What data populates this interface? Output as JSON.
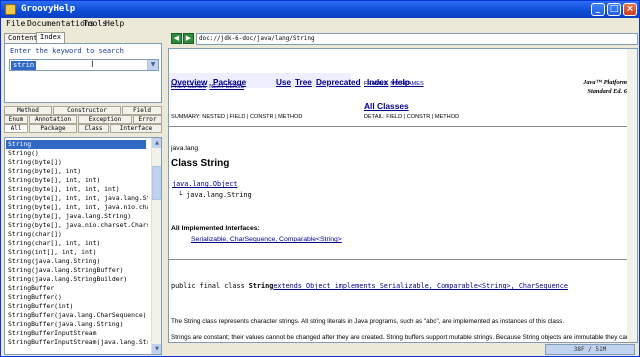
{
  "app": {
    "title": "GroovyHelp",
    "controls": {
      "min": "_",
      "max": "□",
      "close": "×"
    }
  },
  "menu": [
    "File",
    "Documentations",
    "Tools",
    "Help"
  ],
  "left_tabs": [
    "Content",
    "Index"
  ],
  "search": {
    "label": "Enter the keyword to search",
    "value": "strin"
  },
  "filters_row1": [
    "Method",
    "Constructor",
    "Field"
  ],
  "filters_row2": [
    "Enum",
    "Annotation",
    "Exception",
    "Error"
  ],
  "filters_row3": [
    "All",
    "Package",
    "Class",
    "Interface"
  ],
  "results": [
    "String",
    "String()",
    "String(byte[])",
    "String(byte[], int)",
    "String(byte[], int, int)",
    "String(byte[], int, int, int)",
    "String(byte[], int, int, java.lang.String)",
    "String(byte[], int, int, java.nio.charset.C",
    "String(byte[], java.lang.String)",
    "String(byte[], java.nio.charset.Charset)",
    "String(char[])",
    "String(char[], int, int)",
    "String(int[], int, int)",
    "String(java.lang.String)",
    "String(java.lang.StringBuffer)",
    "String(java.lang.StringBuilder)",
    "StringBuffer",
    "StringBuffer()",
    "StringBuffer(int)",
    "StringBuffer(java.lang.CharSequence)",
    "StringBuffer(java.lang.String)",
    "StringBufferInputStream",
    "StringBufferInputStream(java.lang.String)"
  ],
  "url": "doc://jdk-6-doc/java/lang/String",
  "doc": {
    "nav": [
      "Overview",
      "Package",
      "Use",
      "Tree",
      "Deprecated",
      "Index",
      "Help"
    ],
    "platform": [
      "Java™ Platform",
      "Standard Ed. 6"
    ],
    "prev_next": [
      "PREV CLASS",
      "NEXT CLASS"
    ],
    "frames": [
      "FRAMES",
      "NO FRAMES"
    ],
    "all_classes": "All Classes",
    "summary": "SUMMARY: NESTED | FIELD | CONSTR | METHOD",
    "detail": "DETAIL: FIELD | CONSTR | METHOD",
    "package": "java.lang",
    "class_title": "Class String",
    "inherit_parent": "java.lang.Object",
    "inherit_child": "└ java.lang.String",
    "impl_heading": "All Implemented Interfaces:",
    "impl_list": "Serializable, CharSequence, Comparable<String>",
    "declaration_pre": "public final class ",
    "declaration_name": "String",
    "declaration_post": "extends Object implements Serializable, Comparable<String>, CharSequence",
    "para1": "The String class represents character strings. All string literals in Java programs, such as \"abc\", are implemented as instances of this class.",
    "para2": "Strings are constant; their values cannot be changed after they are created. String buffers support mutable strings. Because String objects are immutable they can be shared. For example:"
  },
  "status": "38F / 51M"
}
